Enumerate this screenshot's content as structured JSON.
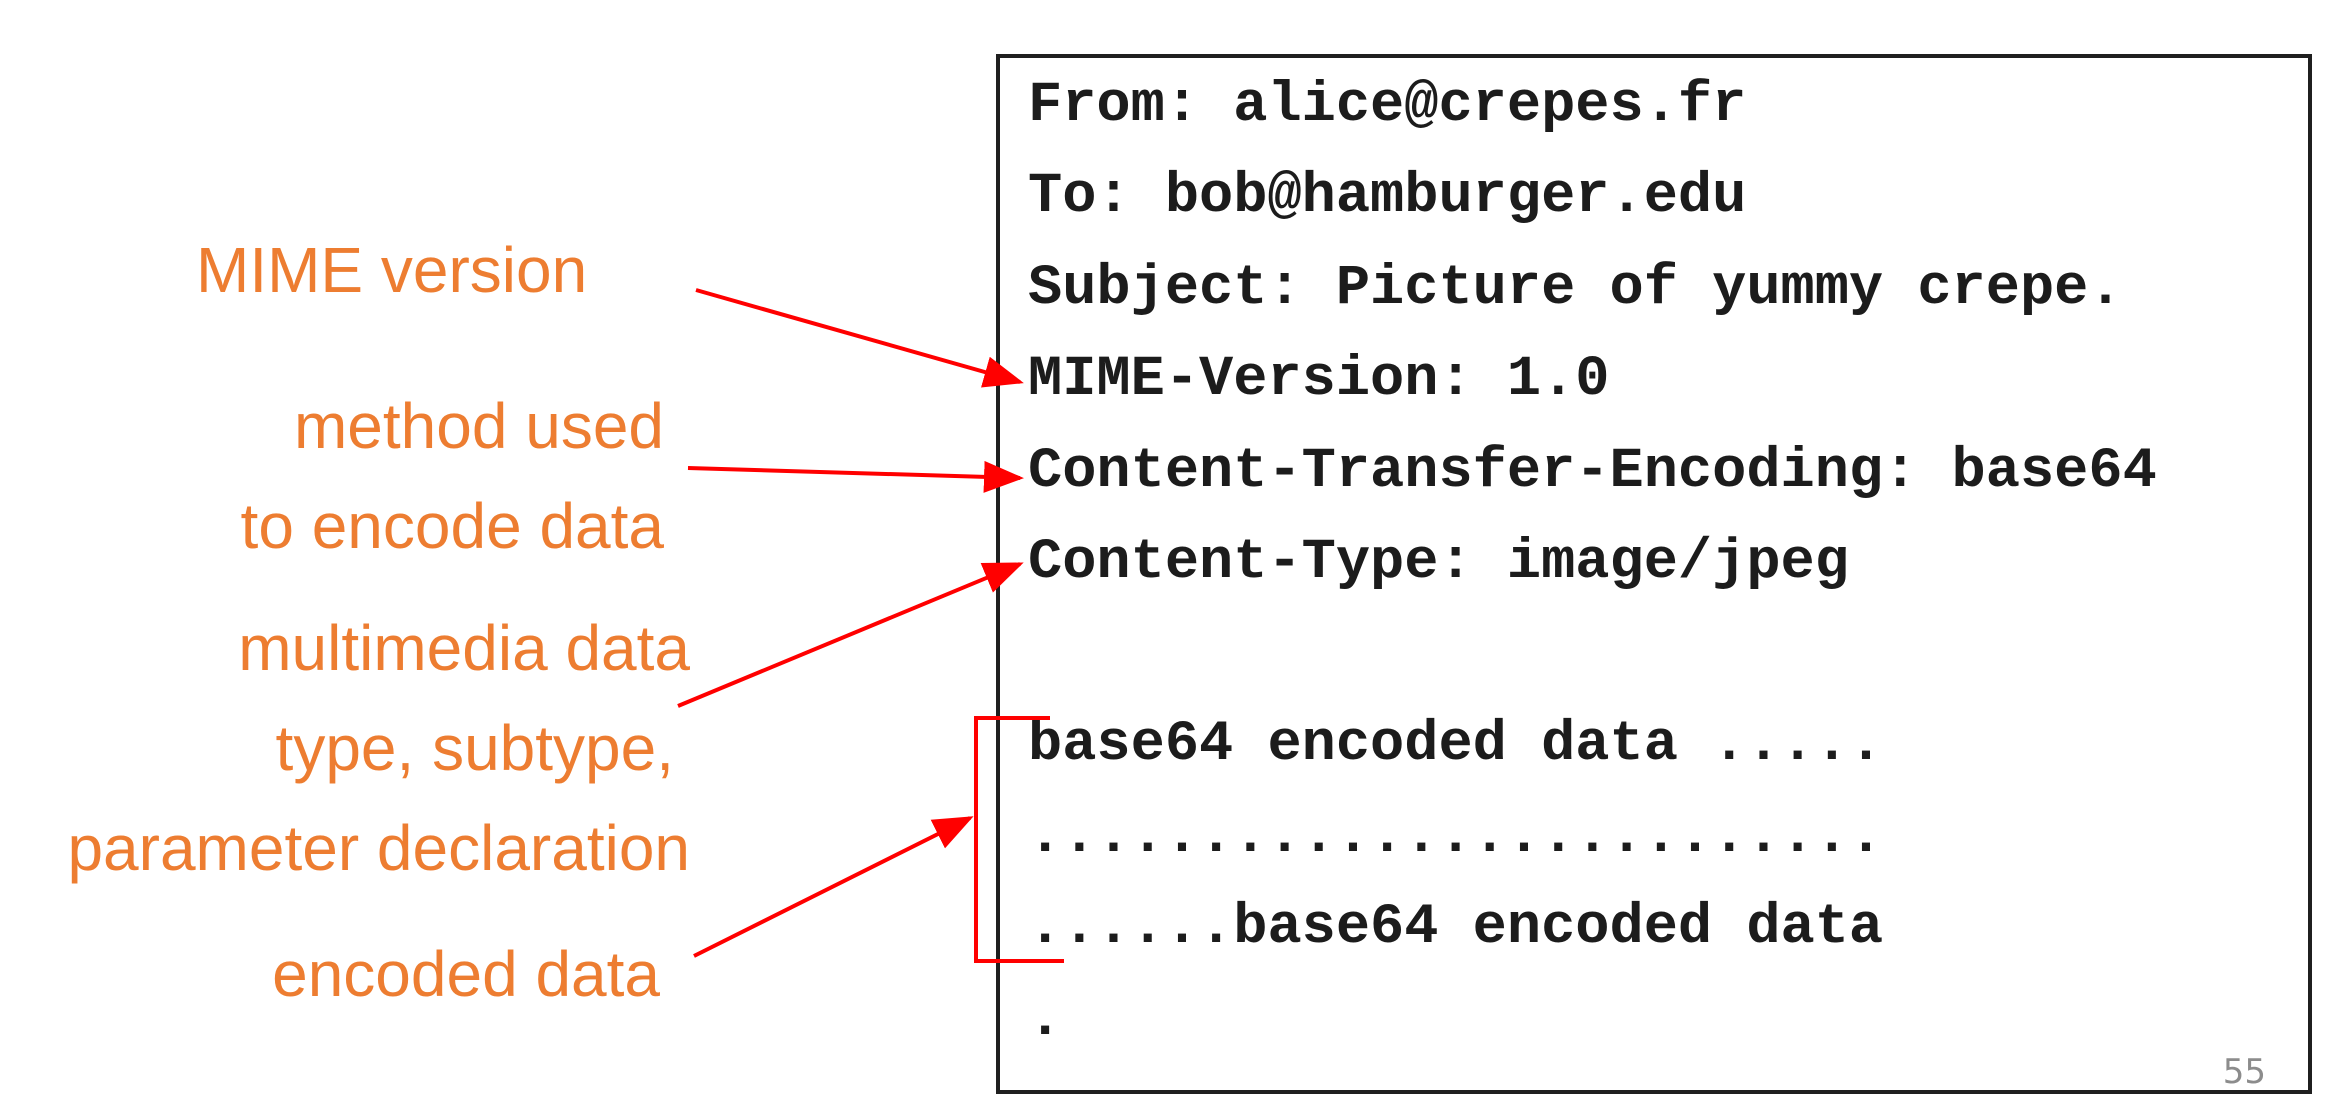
{
  "annotations": {
    "mime_version": "MIME version",
    "encoding_method_line1": "method used",
    "encoding_method_line2": "to encode data",
    "media_type_line1": "multimedia data",
    "media_type_line2": "type, subtype,",
    "media_type_line3": "parameter declaration",
    "encoded_data": "encoded data"
  },
  "email": {
    "from": "From: alice@crepes.fr",
    "to": "To: bob@hamburger.edu",
    "subject": "Subject: Picture of yummy crepe.",
    "mime_version": "MIME-Version: 1.0",
    "transfer_encoding": "Content-Transfer-Encoding: base64",
    "content_type": "Content-Type: image/jpeg",
    "data_line1": "base64 encoded data .....",
    "data_line2": ".........................",
    "data_line3": "......base64 encoded data",
    "end": "."
  },
  "page_number": "55",
  "colors": {
    "annotation_text": "#ED7D31",
    "arrow": "#FF0000",
    "email_text": "#1c1c1c"
  }
}
